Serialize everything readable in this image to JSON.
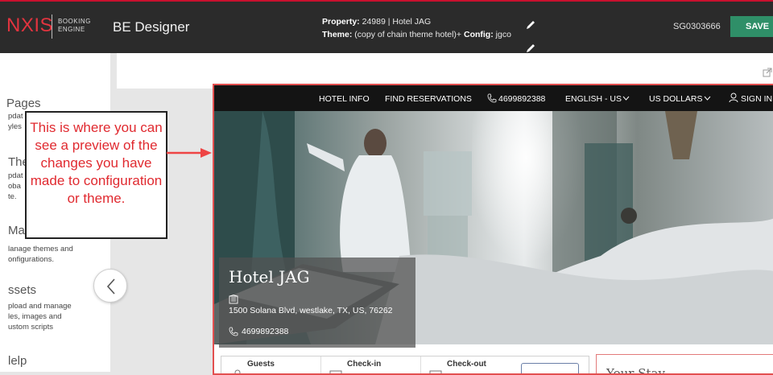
{
  "topbar": {
    "logo_text": "NXIS",
    "logo_sub": "BOOKING ENGINE",
    "app_title": "BE Designer",
    "property_label": "Property:",
    "property_value": "24989 | Hotel JAG",
    "theme_label": "Theme:",
    "theme_value": "(copy of chain theme hotel)+",
    "config_label": "Config:",
    "config_value": "jgco",
    "user_id": "SG0303666",
    "save_label": "SAVE"
  },
  "sidebar": {
    "items": [
      {
        "label": "Pages",
        "desc": [
          "pdat",
          "yles"
        ]
      },
      {
        "label": "The",
        "desc": [
          "pdat",
          "oba",
          "te."
        ]
      },
      {
        "label": "Man",
        "desc": [
          "lanage themes and",
          "onfigurations."
        ]
      },
      {
        "label": "ssets",
        "desc": [
          "pload and manage",
          "les, images and",
          "ustom scripts"
        ]
      },
      {
        "label": "lelp",
        "desc": []
      }
    ]
  },
  "callout": {
    "text": "This is where you can see a preview of the changes you have made to configuration or theme."
  },
  "preview": {
    "nav": {
      "hotel_info": "HOTEL INFO",
      "find_reservations": "FIND RESERVATIONS",
      "phone": "4699892388",
      "language": "ENGLISH - US",
      "currency": "US DOLLARS",
      "sign_in": "SIGN IN"
    },
    "hotel": {
      "name": "Hotel JAG",
      "address": "1500 Solana Blvd, westlake, TX, US, 76262",
      "phone": "4699892388"
    },
    "booking": {
      "guests_label": "Guests",
      "checkin_label": "Check-in",
      "checkout_label": "Check-out"
    },
    "your_stay_label": "Your Stay"
  }
}
